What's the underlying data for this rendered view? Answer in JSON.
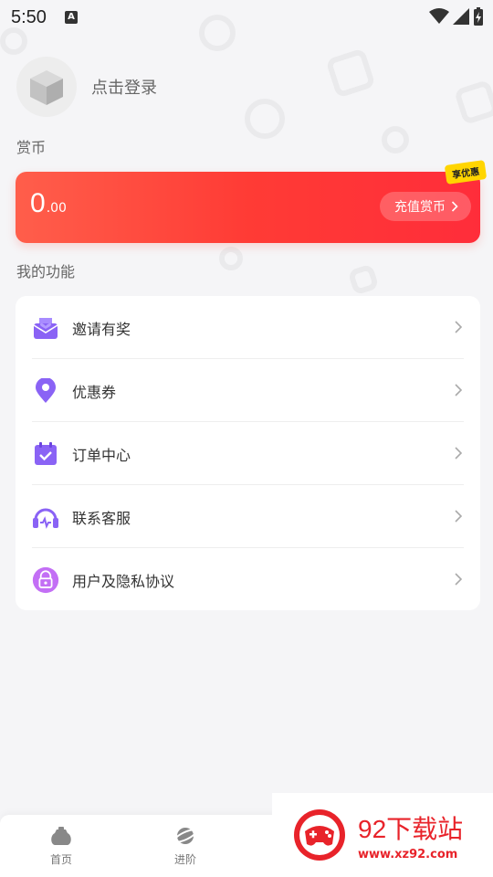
{
  "status_bar": {
    "time": "5:50",
    "notification_icon": "A"
  },
  "profile": {
    "login_text": "点击登录"
  },
  "coins": {
    "section_label": "赏币",
    "amount_int": "0",
    "amount_dec": ".00",
    "recharge_label": "充值赏币",
    "badge": "享优惠"
  },
  "functions": {
    "section_label": "我的功能",
    "items": [
      {
        "label": "邀请有奖",
        "icon": "gift-icon"
      },
      {
        "label": "优惠券",
        "icon": "location-pin-icon"
      },
      {
        "label": "订单中心",
        "icon": "calendar-check-icon"
      },
      {
        "label": "联系客服",
        "icon": "headset-icon"
      },
      {
        "label": "用户及隐私协议",
        "icon": "privacy-lock-icon"
      }
    ]
  },
  "tabbar": {
    "tabs": [
      {
        "label": "首页"
      },
      {
        "label": "进阶"
      }
    ]
  },
  "watermark": {
    "title": "92下载站",
    "url": "www.xz92.com"
  },
  "colors": {
    "accent": "#ff3b35",
    "icon_purple": "#8a63f5",
    "badge": "#ffd500"
  }
}
